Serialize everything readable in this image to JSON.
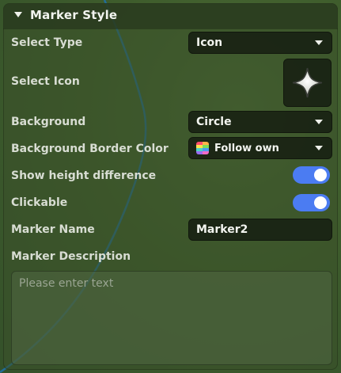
{
  "panel": {
    "title": "Marker Style",
    "select_type": {
      "label": "Select Type",
      "value": "Icon"
    },
    "select_icon": {
      "label": "Select Icon",
      "icon": "four-point-star-icon"
    },
    "background": {
      "label": "Background",
      "value": "Circle"
    },
    "border_color": {
      "label": "Background Border Color",
      "value": "Follow own",
      "swatch_icon": "rainbow-swatch-icon"
    },
    "height_diff": {
      "label": "Show height difference",
      "enabled": true
    },
    "clickable": {
      "label": "Clickable",
      "enabled": true
    },
    "marker_name": {
      "label": "Marker Name",
      "value": "Marker2"
    },
    "marker_description": {
      "label": "Marker Description",
      "placeholder": "Please enter text",
      "value": ""
    }
  },
  "colors": {
    "toggle_on": "#4b7cf2",
    "map_path": "#1f6fa4",
    "panel_header": "#28381e",
    "field_bg": "#161e12"
  }
}
